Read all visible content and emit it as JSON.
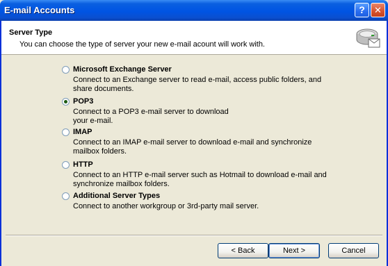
{
  "window": {
    "title": "E-mail Accounts",
    "help_glyph": "?",
    "close_glyph": "✕"
  },
  "header": {
    "title": "Server Type",
    "description": "You can choose the type of server your new e-mail acount will work with.",
    "icon": "mail-server-icon"
  },
  "options": [
    {
      "label": "Microsoft Exchange Server",
      "description": "Connect to an Exchange server to read e-mail, access public folders, and share documents.",
      "selected": false
    },
    {
      "label": "POP3",
      "description": "Connect to a POP3 e-mail server to download your e-mail.",
      "selected": true
    },
    {
      "label": "IMAP",
      "description": "Connect to an IMAP e-mail server to download e-mail and synchronize mailbox folders.",
      "selected": false
    },
    {
      "label": "HTTP",
      "description": "Connect to an HTTP e-mail server such as Hotmail to download e-mail and synchronize mailbox folders.",
      "selected": false
    },
    {
      "label": "Additional Server Types",
      "description": "Connect to another workgroup or 3rd-party mail server.",
      "selected": false
    }
  ],
  "buttons": {
    "back": "< Back",
    "next": "Next >",
    "cancel": "Cancel"
  },
  "colors": {
    "titlebar": "#0054e3",
    "dialog_bg": "#ece9d8",
    "header_bg": "#ffffff"
  }
}
